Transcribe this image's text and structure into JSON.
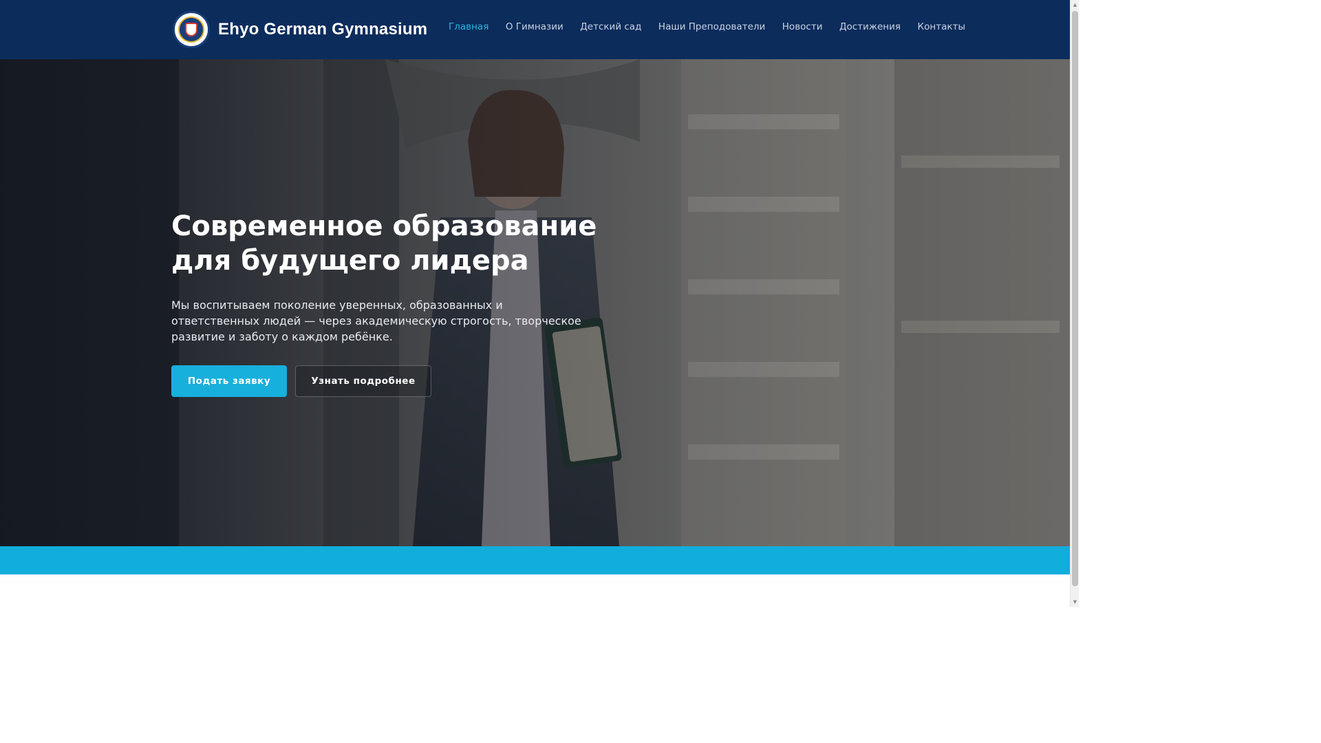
{
  "header": {
    "brand_name": "Ehyo German Gymnasium",
    "logo_icon": "school-crest-icon",
    "nav": [
      {
        "label": "Главная",
        "active": true
      },
      {
        "label": "О Гимназии",
        "active": false
      },
      {
        "label": "Детский сад",
        "active": false
      },
      {
        "label": "Наши Преподователи",
        "active": false
      },
      {
        "label": "Новости",
        "active": false
      },
      {
        "label": "Достижения",
        "active": false
      },
      {
        "label": "Контакты",
        "active": false
      }
    ]
  },
  "hero": {
    "title_line1": "Современное образование",
    "title_line2": "для будущего лидера",
    "text": "Мы воспитываем поколение уверенных, образованных и ответственных людей — через академическую строгость, творческое развитие и заботу о каждом ребёнке.",
    "primary_button": "Подать заявку",
    "secondary_button": "Узнать подробнее",
    "background_image": "student-with-books-photo"
  },
  "colors": {
    "navbar": "#0c2c5c",
    "accent": "#17b0dc",
    "nav_active": "#2ab5e0",
    "band": "#11aedb"
  }
}
